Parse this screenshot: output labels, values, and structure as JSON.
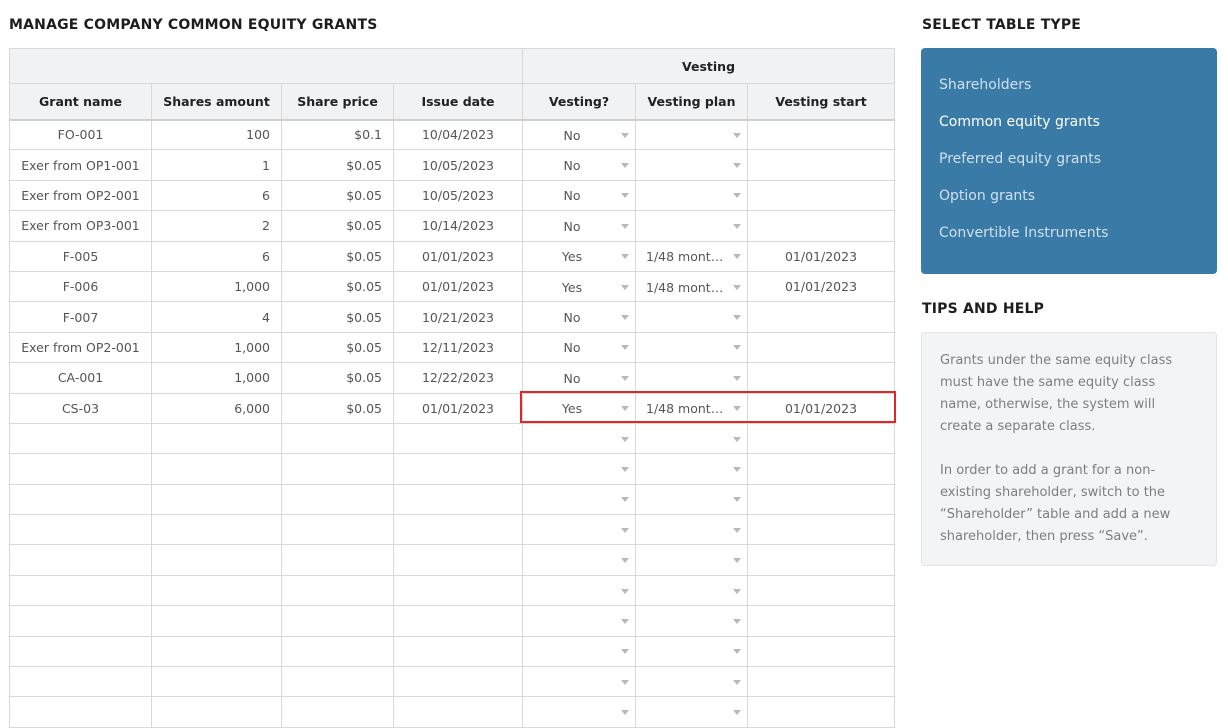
{
  "page_title": "MANAGE COMPANY COMMON EQUITY GRANTS",
  "table": {
    "group_header": "Vesting",
    "columns": [
      "Grant name",
      "Shares amount",
      "Share price",
      "Issue date",
      "Vesting?",
      "Vesting plan",
      "Vesting start"
    ],
    "rows": [
      {
        "name": "FO-001",
        "shares": "100",
        "price": "$0.1",
        "issue_date": "10/04/2023",
        "vesting": "No",
        "plan": "",
        "start": ""
      },
      {
        "name": "Exer from OP1-001",
        "shares": "1",
        "price": "$0.05",
        "issue_date": "10/05/2023",
        "vesting": "No",
        "plan": "",
        "start": ""
      },
      {
        "name": "Exer from OP2-001",
        "shares": "6",
        "price": "$0.05",
        "issue_date": "10/05/2023",
        "vesting": "No",
        "plan": "",
        "start": ""
      },
      {
        "name": "Exer from OP3-001",
        "shares": "2",
        "price": "$0.05",
        "issue_date": "10/14/2023",
        "vesting": "No",
        "plan": "",
        "start": ""
      },
      {
        "name": "F-005",
        "shares": "6",
        "price": "$0.05",
        "issue_date": "01/01/2023",
        "vesting": "Yes",
        "plan": "1/48 month...",
        "start": "01/01/2023"
      },
      {
        "name": "F-006",
        "shares": "1,000",
        "price": "$0.05",
        "issue_date": "01/01/2023",
        "vesting": "Yes",
        "plan": "1/48 month...",
        "start": "01/01/2023"
      },
      {
        "name": "F-007",
        "shares": "4",
        "price": "$0.05",
        "issue_date": "10/21/2023",
        "vesting": "No",
        "plan": "",
        "start": ""
      },
      {
        "name": "Exer from OP2-001",
        "shares": "1,000",
        "price": "$0.05",
        "issue_date": "12/11/2023",
        "vesting": "No",
        "plan": "",
        "start": ""
      },
      {
        "name": "CA-001",
        "shares": "1,000",
        "price": "$0.05",
        "issue_date": "12/22/2023",
        "vesting": "No",
        "plan": "",
        "start": ""
      },
      {
        "name": "CS-03",
        "shares": "6,000",
        "price": "$0.05",
        "issue_date": "01/01/2023",
        "vesting": "Yes",
        "plan": "1/48 month...",
        "start": "01/01/2023"
      }
    ],
    "empty_rows": 10
  },
  "sidebar": {
    "select_title": "SELECT TABLE TYPE",
    "items": [
      {
        "label": "Shareholders",
        "active": false
      },
      {
        "label": "Common equity grants",
        "active": true
      },
      {
        "label": "Preferred equity grants",
        "active": false
      },
      {
        "label": "Option grants",
        "active": false
      },
      {
        "label": "Convertible Instruments",
        "active": false
      }
    ],
    "tips_title": "TIPS AND HELP",
    "tips": [
      "Grants under the same equity class must have the same equity class name, otherwise, the system will create a separate class.",
      "In order to add a grant for a non-existing shareholder, switch to the “Shareholder” table and add a new shareholder, then press “Save”."
    ]
  },
  "colors": {
    "panel_bg": "#3a7aa6",
    "highlight": "#e0262b"
  },
  "icons": {
    "dropdown": "caret-down-icon"
  }
}
